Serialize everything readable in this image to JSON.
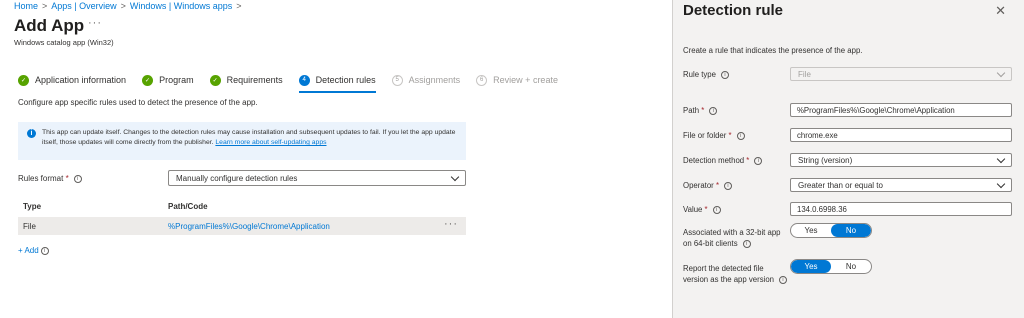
{
  "breadcrumb": [
    "Home",
    "Apps | Overview",
    "Windows | Windows apps"
  ],
  "header": {
    "title": "Add App",
    "more": "···",
    "subtitle": "Windows catalog app (Win32)"
  },
  "steps": [
    {
      "label": "Application information",
      "state": "done",
      "marker": "✓"
    },
    {
      "label": "Program",
      "state": "done",
      "marker": "✓"
    },
    {
      "label": "Requirements",
      "state": "done",
      "marker": "✓"
    },
    {
      "label": "Detection rules",
      "state": "active",
      "marker": "4"
    },
    {
      "label": "Assignments",
      "state": "pending",
      "marker": "5"
    },
    {
      "label": "Review + create",
      "state": "pending",
      "marker": "6"
    }
  ],
  "intro": "Configure app specific rules used to detect the presence of the app.",
  "info_banner": {
    "text": "This app can update itself. Changes to the detection rules may cause installation and subsequent updates to fail. If you let the app update itself, those updates will come directly from the publisher.",
    "link": "Learn more about self-updating apps"
  },
  "rules_format": {
    "label": "Rules format",
    "value": "Manually configure detection rules"
  },
  "table": {
    "headers": {
      "type": "Type",
      "path": "Path/Code"
    },
    "rows": [
      {
        "type": "File",
        "path": "%ProgramFiles%\\Google\\Chrome\\Application",
        "more": "···"
      }
    ]
  },
  "add_link": "+ Add",
  "panel": {
    "title": "Detection rule",
    "close": "✕",
    "description": "Create a rule that indicates the presence of the app.",
    "rule_type": {
      "label": "Rule type",
      "value": "File"
    },
    "path": {
      "label": "Path",
      "value": "%ProgramFiles%\\Google\\Chrome\\Application"
    },
    "file_or_folder": {
      "label": "File or folder",
      "value": "chrome.exe"
    },
    "detection_method": {
      "label": "Detection method",
      "value": "String (version)"
    },
    "operator": {
      "label": "Operator",
      "value": "Greater than or equal to"
    },
    "value": {
      "label": "Value",
      "value": "134.0.6998.36"
    },
    "assoc_32bit": {
      "label_line1": "Associated with a 32-bit app",
      "label_line2": "on 64-bit clients",
      "yes": "Yes",
      "no": "No",
      "selected": "No"
    },
    "report_version": {
      "label_line1": "Report the detected file",
      "label_line2": "version as the app version",
      "yes": "Yes",
      "no": "No",
      "selected": "Yes"
    }
  },
  "colors": {
    "accent": "#0078d4",
    "success": "#57a300",
    "required": "#a4262c"
  }
}
